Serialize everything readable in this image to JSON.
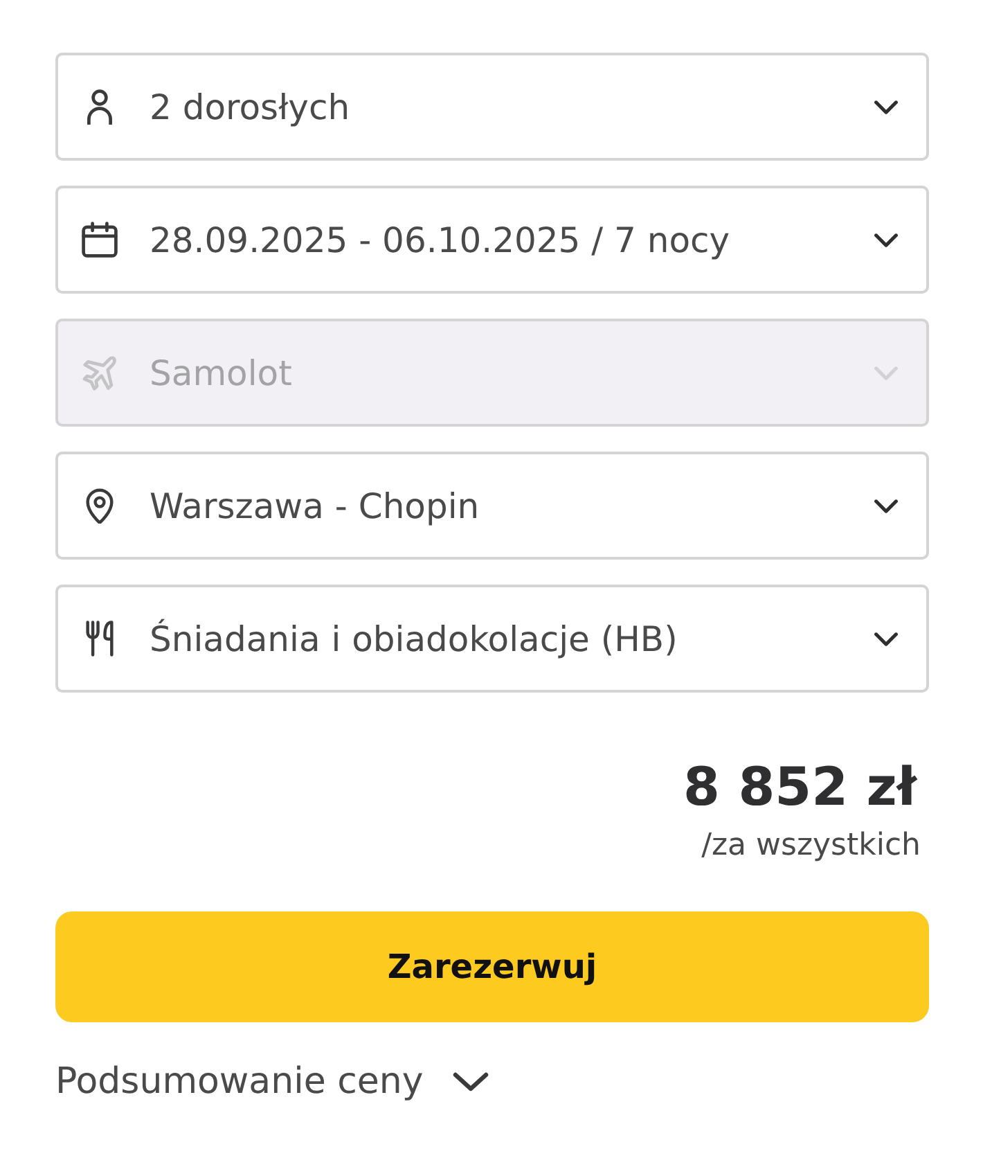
{
  "selects": [
    {
      "kind": "guests",
      "value": "2 dorosłych",
      "disabled": false
    },
    {
      "kind": "dates",
      "value": "28.09.2025 - 06.10.2025 / 7 nocy",
      "disabled": false
    },
    {
      "kind": "transport",
      "value": "Samolot",
      "disabled": true
    },
    {
      "kind": "departure",
      "value": "Warszawa - Chopin",
      "disabled": false
    },
    {
      "kind": "board",
      "value": "Śniadania i obiadokolacje (HB)",
      "disabled": false
    }
  ],
  "price": {
    "amount": "8 852 zł",
    "note": "/za wszystkich"
  },
  "book_button": {
    "label": "Zarezerwuj"
  },
  "summary_toggle": {
    "label": "Podsumowanie ceny",
    "expanded": false
  }
}
